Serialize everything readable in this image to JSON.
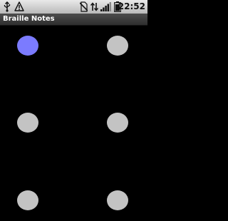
{
  "status_bar": {
    "time": "22:52",
    "icons": [
      "usb-icon",
      "warning-icon",
      "no-sim-icon",
      "data-sync-icon",
      "signal-icon",
      "battery-icon"
    ]
  },
  "app": {
    "title": "Braille Notes"
  },
  "braille_cell": {
    "colors": {
      "active": "#7b7bff",
      "inactive": "#c3c3c3",
      "background": "#000000"
    },
    "dots": [
      {
        "number": 1,
        "active": true
      },
      {
        "number": 2,
        "active": false
      },
      {
        "number": 3,
        "active": false
      },
      {
        "number": 4,
        "active": false
      },
      {
        "number": 5,
        "active": false
      },
      {
        "number": 6,
        "active": false
      }
    ]
  }
}
